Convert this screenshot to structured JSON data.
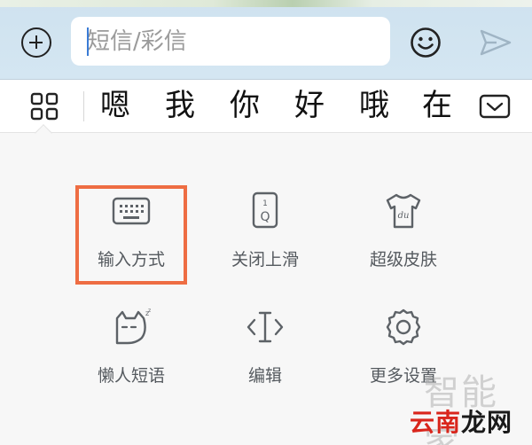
{
  "compose": {
    "placeholder": "短信/彩信"
  },
  "candidates": {
    "words": [
      "嗯",
      "我",
      "你",
      "好",
      "哦",
      "在"
    ]
  },
  "panel": {
    "items": [
      {
        "label": "输入方式",
        "icon": "keyboard-icon"
      },
      {
        "label": "关闭上滑",
        "icon": "swipe-key-icon"
      },
      {
        "label": "超级皮肤",
        "icon": "tshirt-skin-icon"
      },
      {
        "label": "懒人短语",
        "icon": "sleepy-cat-icon"
      },
      {
        "label": "编辑",
        "icon": "text-cursor-icon"
      },
      {
        "label": "更多设置",
        "icon": "gear-icon"
      }
    ],
    "highlight_color": "#ee6d43"
  },
  "watermark": {
    "faint": "智能家",
    "logo_part1": "云南",
    "logo_part2": "龙网"
  }
}
